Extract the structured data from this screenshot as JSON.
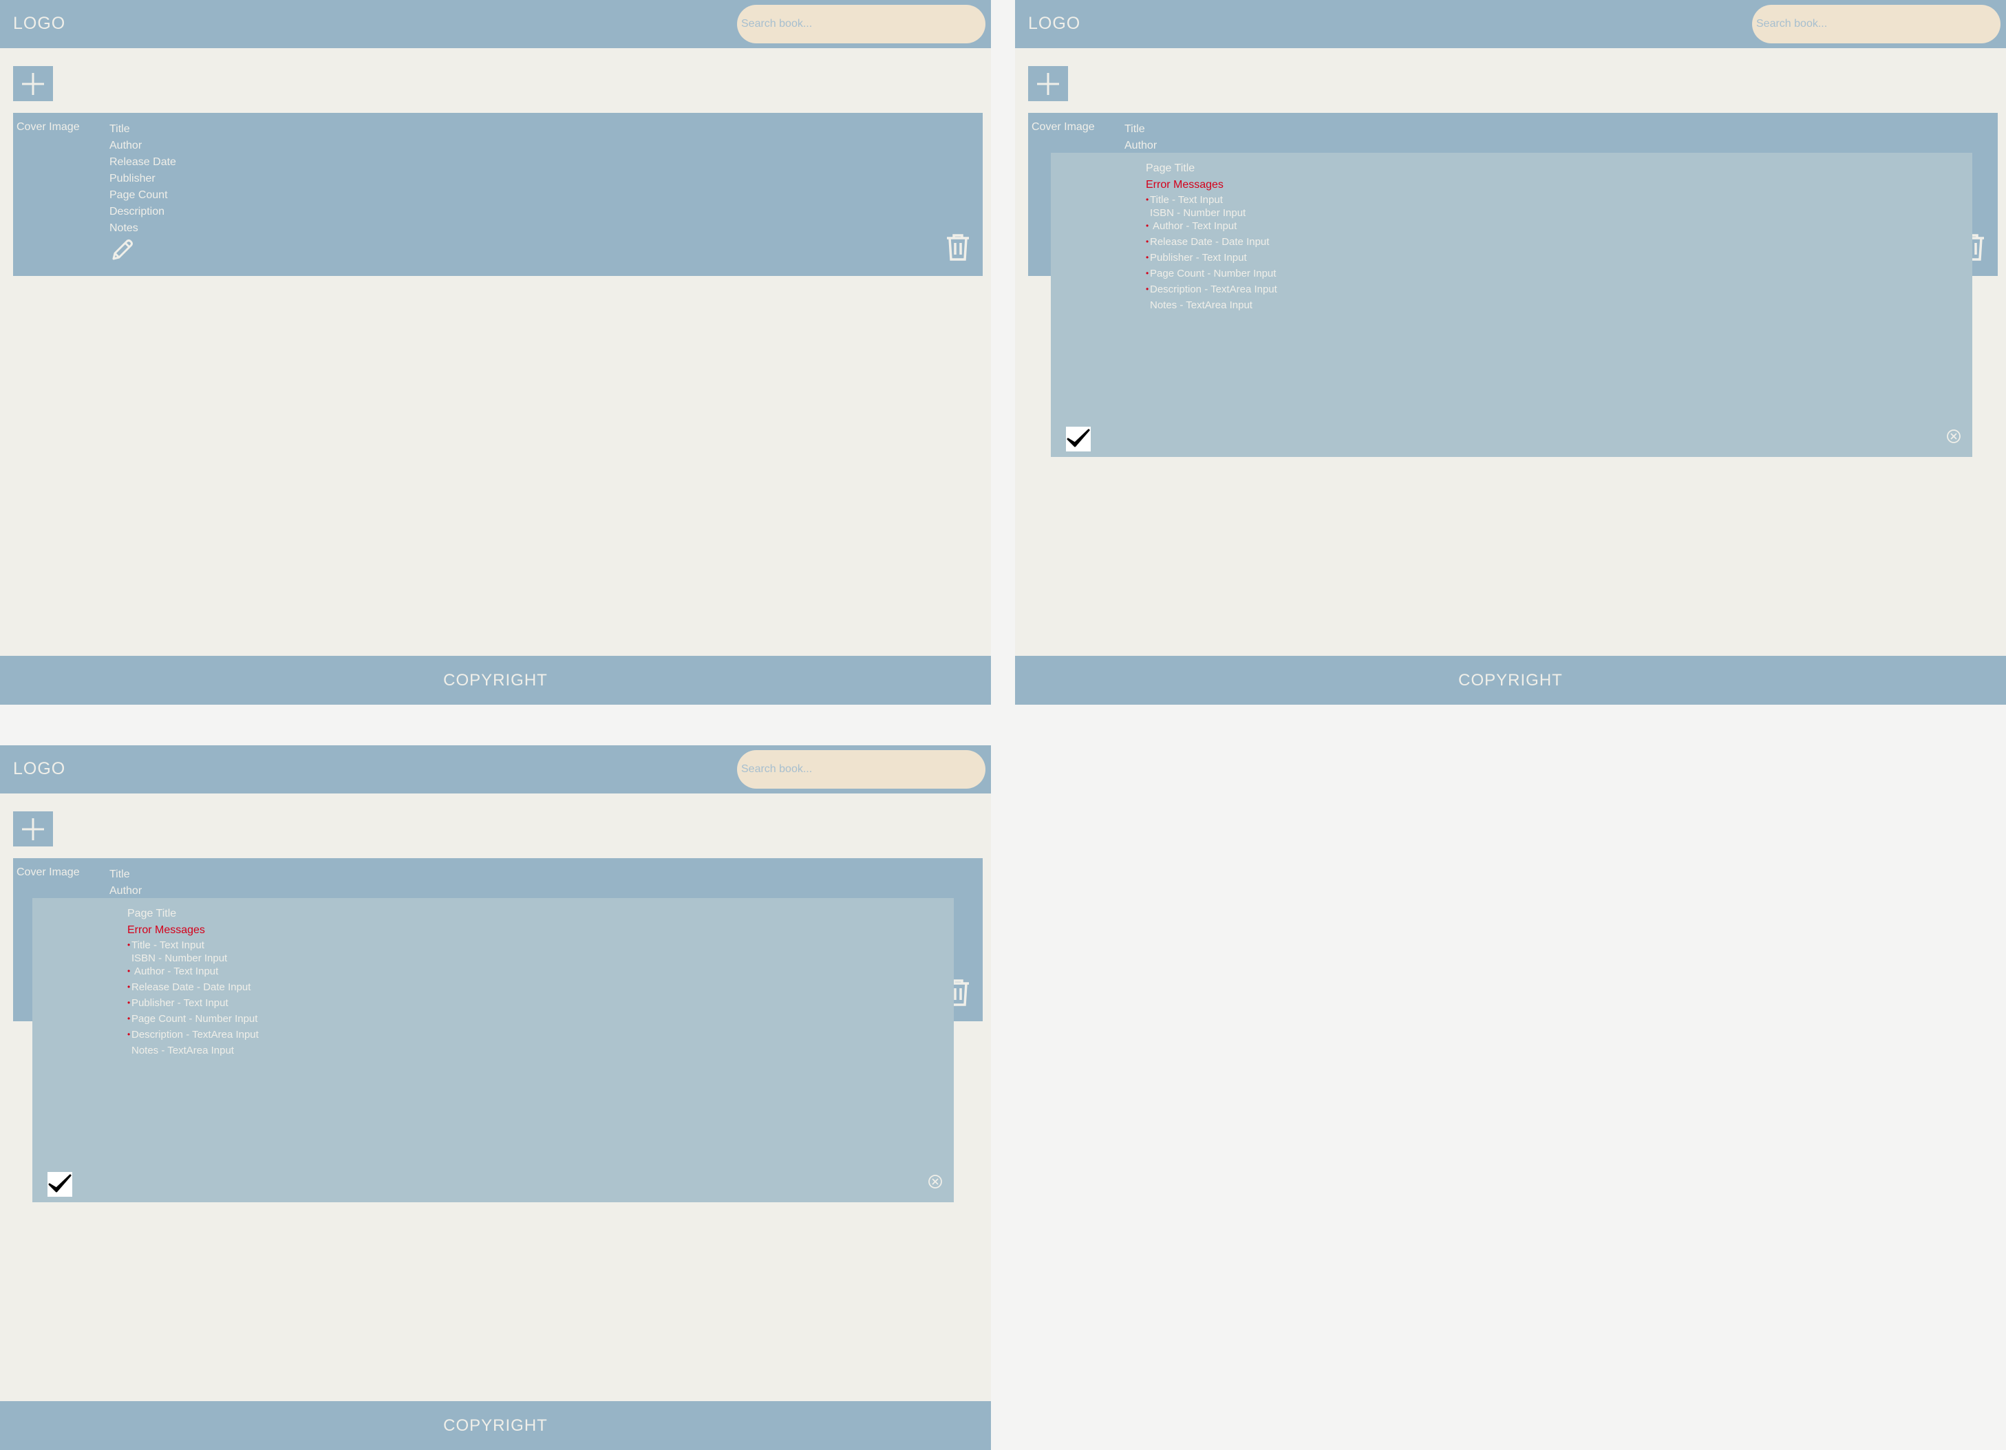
{
  "header": {
    "logo": "LOGO",
    "search_placeholder": "Search book..."
  },
  "book_card": {
    "cover_label": "Cover Image",
    "fields": [
      "Title",
      "Author",
      "Release Date",
      "Publisher",
      "Page Count",
      "Description",
      "Notes"
    ],
    "collapsed_fields": [
      "Title",
      "Author"
    ]
  },
  "modal": {
    "title": "Page Title",
    "error_messages": "Error Messages",
    "fields": [
      {
        "label": "Title - Text Input",
        "required": true
      },
      {
        "label": "ISBN - Number Input",
        "required": false
      },
      {
        "label": "Author - Text Input",
        "required": true
      },
      {
        "label": "Release Date - Date Input",
        "required": true
      },
      {
        "label": "Publisher - Text Input",
        "required": true
      },
      {
        "label": "Page Count - Number Input",
        "required": true
      },
      {
        "label": "Description - TextArea Input",
        "required": true
      },
      {
        "label": "Notes - TextArea Input",
        "required": false
      }
    ]
  },
  "footer": {
    "copyright": "COPYRIGHT"
  },
  "colors": {
    "primary": "#97b4c6",
    "background": "#f0efe9",
    "search_bg": "#efe3cf",
    "modal_bg": "#adc3cd",
    "error": "#d4001a"
  }
}
